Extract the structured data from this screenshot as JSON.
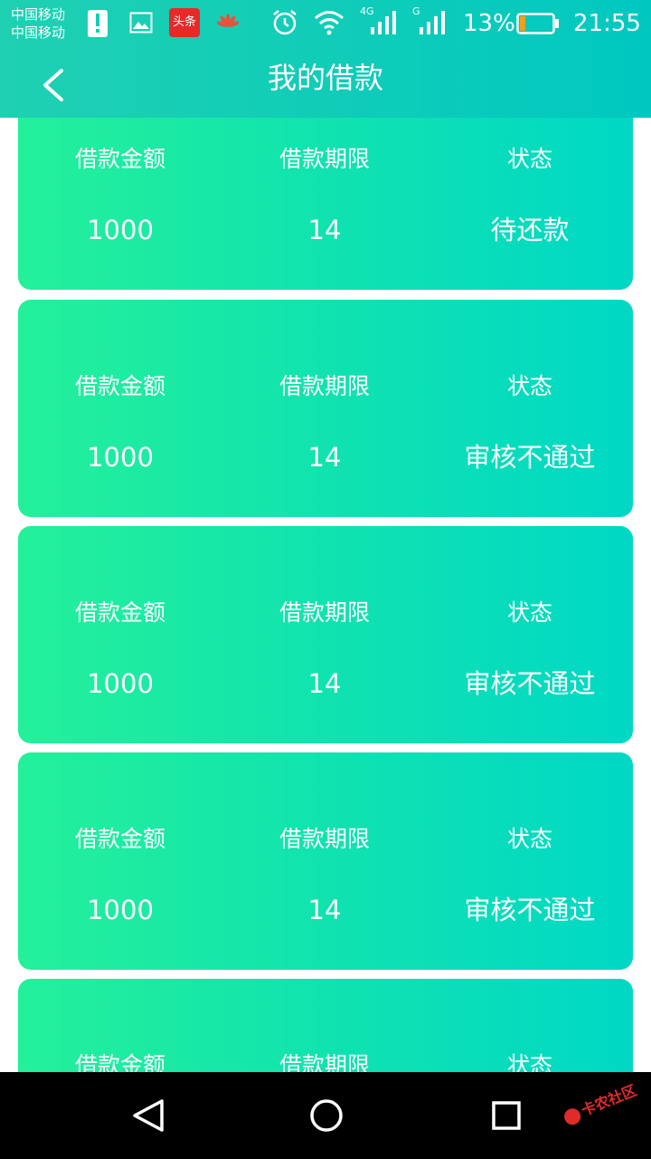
{
  "status_bar": {
    "carrier_1": "中国移动",
    "carrier_2": "中国移动",
    "news_badge": "头条",
    "net_4g": "4G",
    "net_g": "G",
    "battery": "13%",
    "time": "21:55",
    "icons": [
      "alert-icon",
      "gallery-icon",
      "toutiao-app-icon",
      "huawei-icon",
      "alarm-icon",
      "wifi-icon",
      "signal-4g-icon",
      "signal-g-icon",
      "battery-icon"
    ]
  },
  "header": {
    "title": "我的借款",
    "back_icon": "chevron-left-icon"
  },
  "loans": [
    {
      "amount_label": "借款金额",
      "term_label": "借款期限",
      "status_label": "状态",
      "amount": "1000",
      "term": "14",
      "status": "待还款"
    },
    {
      "amount_label": "借款金额",
      "term_label": "借款期限",
      "status_label": "状态",
      "amount": "1000",
      "term": "14",
      "status": "审核不通过"
    },
    {
      "amount_label": "借款金额",
      "term_label": "借款期限",
      "status_label": "状态",
      "amount": "1000",
      "term": "14",
      "status": "审核不通过"
    },
    {
      "amount_label": "借款金额",
      "term_label": "借款期限",
      "status_label": "状态",
      "amount": "1000",
      "term": "14",
      "status": "审核不通过"
    },
    {
      "amount_label": "借款金额",
      "term_label": "借款期限",
      "status_label": "状态",
      "amount": "",
      "term": "",
      "status": ""
    }
  ],
  "nav_bar": {
    "icons": [
      "back-triangle-icon",
      "home-circle-icon",
      "recents-square-icon"
    ]
  },
  "watermark": {
    "text": "卡农社区"
  },
  "colors": {
    "header_start": "#1fd0b2",
    "header_end": "#00c8c0",
    "card_start": "#24f09a",
    "card_end": "#00d8c5",
    "nav_bar": "#000000"
  }
}
